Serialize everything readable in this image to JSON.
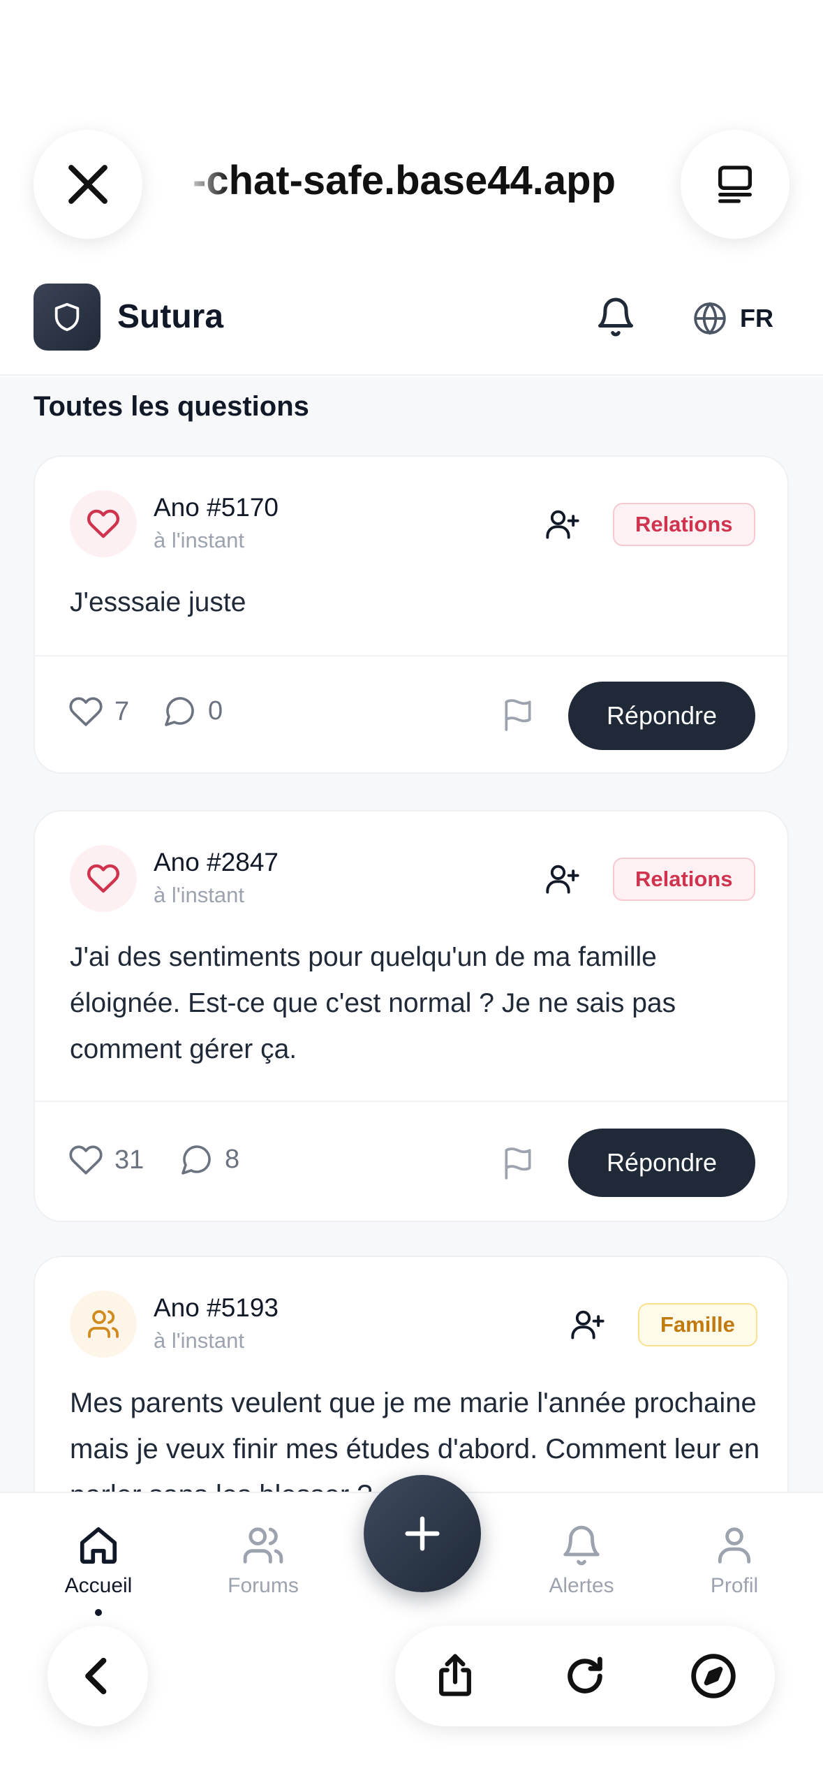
{
  "browser": {
    "url": "-chat-safe.base44.app"
  },
  "header": {
    "brand": "Sutura",
    "language": "FR"
  },
  "feed": {
    "section_title": "Toutes les questions",
    "posts": [
      {
        "author": "Ano #5170",
        "time": "à l'instant",
        "tag": "Relations",
        "content": "J'esssaie juste",
        "likes": "7",
        "comments": "0",
        "reply_label": "Répondre"
      },
      {
        "author": "Ano #2847",
        "time": "à l'instant",
        "tag": "Relations",
        "content": "J'ai des sentiments pour quelqu'un de ma famille éloignée. Est-ce que c'est normal ? Je ne sais pas comment gérer ça.",
        "likes": "31",
        "comments": "8",
        "reply_label": "Répondre"
      },
      {
        "author": "Ano #5193",
        "time": "à l'instant",
        "tag": "Famille",
        "content": "Mes parents veulent que je me marie l'année prochaine mais je veux finir mes études d'abord. Comment leur en parler sans les blesser ?"
      }
    ]
  },
  "nav": {
    "items": [
      {
        "label": "Accueil",
        "icon": "home-icon",
        "active": true
      },
      {
        "label": "Forums",
        "icon": "users-icon",
        "active": false
      },
      {
        "label": "Alertes",
        "icon": "bell-icon",
        "active": false
      },
      {
        "label": "Profil",
        "icon": "user-icon",
        "active": false
      }
    ],
    "fab_icon": "plus-icon"
  },
  "colors": {
    "primary": "#1f2937",
    "relations_tag": "#d0334e",
    "famille_tag": "#c07a10",
    "muted": "#9ca3af"
  }
}
